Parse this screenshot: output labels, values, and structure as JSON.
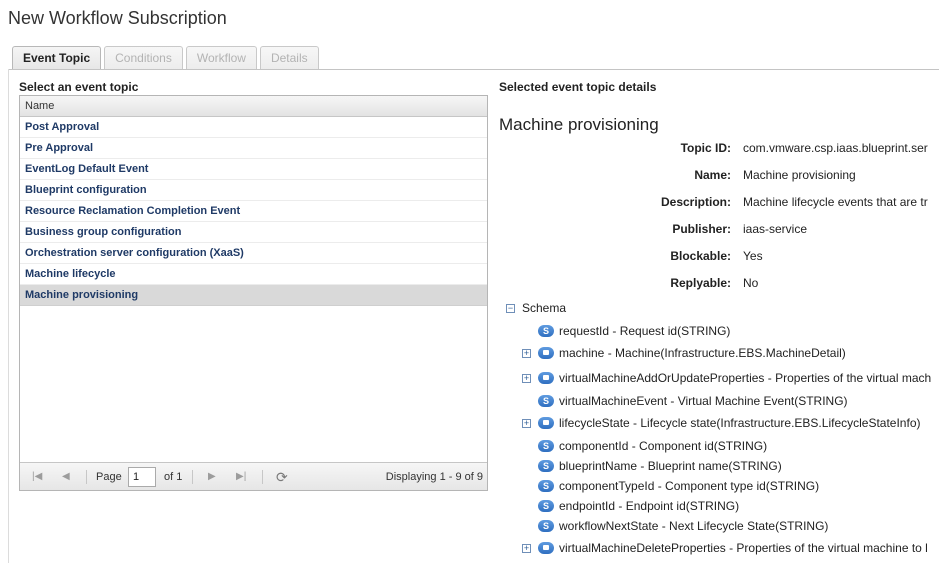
{
  "page_title": "New Workflow Subscription",
  "tabs": [
    {
      "label": "Event Topic",
      "active": true
    },
    {
      "label": "Conditions",
      "active": false
    },
    {
      "label": "Workflow",
      "active": false
    },
    {
      "label": "Details",
      "active": false
    }
  ],
  "left": {
    "heading": "Select an event topic",
    "column_header": "Name",
    "rows": [
      "Post Approval",
      "Pre Approval",
      "EventLog Default Event",
      "Blueprint configuration",
      "Resource Reclamation Completion Event",
      "Business group configuration",
      "Orchestration server configuration (XaaS)",
      "Machine lifecycle",
      "Machine provisioning"
    ],
    "selected_row": "Machine provisioning",
    "pager": {
      "page_label": "Page",
      "page_value": "1",
      "of_label": "of 1",
      "display_text": "Displaying 1 - 9 of 9"
    }
  },
  "right": {
    "heading": "Selected event topic details",
    "topic_name": "Machine provisioning",
    "props": {
      "topic_id": {
        "label": "Topic ID:",
        "value": "com.vmware.csp.iaas.blueprint.ser"
      },
      "name": {
        "label": "Name:",
        "value": "Machine provisioning"
      },
      "description": {
        "label": "Description:",
        "value": "Machine lifecycle events that are tr"
      },
      "publisher": {
        "label": "Publisher:",
        "value": "iaas-service"
      },
      "blockable": {
        "label": "Blockable:",
        "value": "Yes"
      },
      "replyable": {
        "label": "Replyable:",
        "value": "No"
      }
    },
    "schema": {
      "label": "Schema",
      "nodes": [
        {
          "text": "requestId - Request id(STRING)",
          "type": "string",
          "expandable": false
        },
        {
          "text": "machine - Machine(Infrastructure.EBS.MachineDetail)",
          "type": "object",
          "expandable": true
        },
        {
          "text": "virtualMachineAddOrUpdateProperties - Properties of the virtual mach",
          "type": "object",
          "expandable": true
        },
        {
          "text": "virtualMachineEvent - Virtual Machine Event(STRING)",
          "type": "string",
          "expandable": false
        },
        {
          "text": "lifecycleState - Lifecycle state(Infrastructure.EBS.LifecycleStateInfo)",
          "type": "object",
          "expandable": true
        },
        {
          "text": "componentId - Component id(STRING)",
          "type": "string",
          "expandable": false
        },
        {
          "text": "blueprintName - Blueprint name(STRING)",
          "type": "string",
          "expandable": false
        },
        {
          "text": "componentTypeId - Component type id(STRING)",
          "type": "string",
          "expandable": false
        },
        {
          "text": "endpointId - Endpoint id(STRING)",
          "type": "string",
          "expandable": false
        },
        {
          "text": "workflowNextState - Next Lifecycle State(STRING)",
          "type": "string",
          "expandable": false
        },
        {
          "text": "virtualMachineDeleteProperties - Properties of the virtual machine to l",
          "type": "object",
          "expandable": true
        }
      ]
    }
  }
}
